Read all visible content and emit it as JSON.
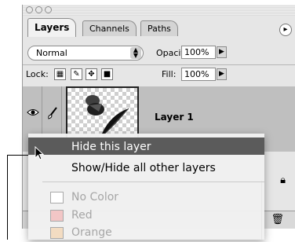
{
  "tabs": [
    {
      "label": "Layers"
    },
    {
      "label": "Channels"
    },
    {
      "label": "Paths"
    }
  ],
  "panel_menu_glyph": "▸",
  "blend_mode": {
    "value": "Normal"
  },
  "opacity": {
    "label": "Opacity:",
    "value": "100%"
  },
  "lock": {
    "label": "Lock:"
  },
  "fill": {
    "label": "Fill:",
    "value": "100%"
  },
  "layer": {
    "name": "Layer 1"
  },
  "context_menu": {
    "items": [
      {
        "label": "Hide this layer",
        "highlighted": true
      },
      {
        "label": "Show/Hide all other layers",
        "highlighted": false
      }
    ],
    "colors": [
      {
        "label": "No Color",
        "swatch": "#ffffff"
      },
      {
        "label": "Red",
        "swatch": "#f2c6c6"
      },
      {
        "label": "Orange",
        "swatch": "#f3dcc2"
      }
    ]
  },
  "colors": {
    "highlight": "#5b5b5b",
    "panel": "#e6e6e6",
    "layer_row": "#bfbfbf"
  }
}
